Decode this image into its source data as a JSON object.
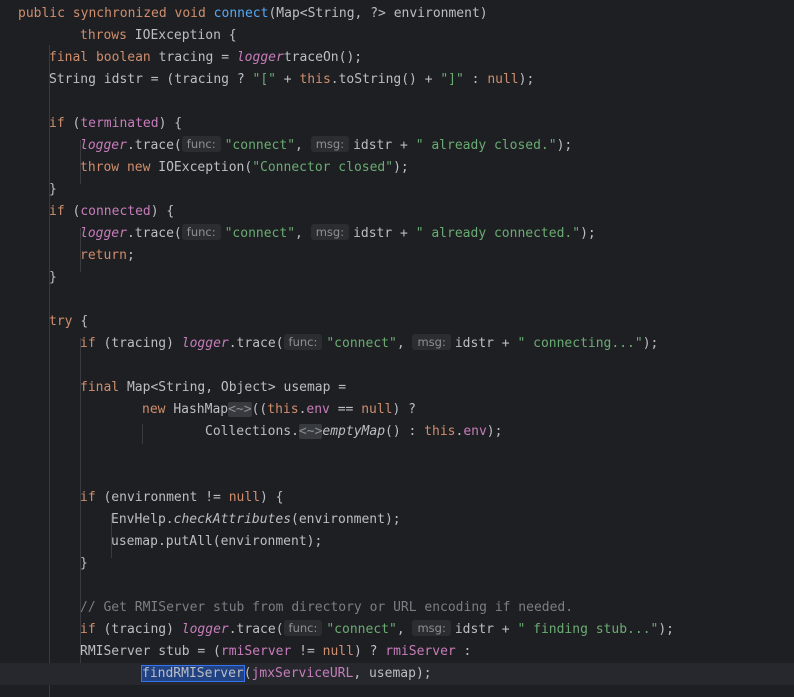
{
  "code": {
    "l1": {
      "t1": "public synchronized void ",
      "t2": "connect",
      "t3": "(Map<String, ?> environment)"
    },
    "l2": {
      "t1": "throws ",
      "t2": "IOException {"
    },
    "l3": {
      "t1": "final boolean ",
      "t2": "tracing = ",
      "t3": "logger",
      ".": ".",
      "t4": "traceOn();"
    },
    "l4": {
      "t1": "String idstr = (tracing ? ",
      "t2": "\"[\"",
      "t3": " + ",
      "t4": "this",
      "t5": ".toString() + ",
      "t6": "\"]\"",
      "t7": " : ",
      "t8": "null",
      "t9": ");"
    },
    "l5": {
      "t1": "if ",
      "t2": "(",
      "t3": "terminated",
      "t4": ") {"
    },
    "l6": {
      "t1": "logger",
      "t2": ".trace(",
      "h1": "func:",
      "t3": "\"connect\"",
      "t4": ", ",
      "h2": "msg:",
      "t5": "idstr + ",
      "t6": "\" already closed.\"",
      "t7": ");"
    },
    "l7": {
      "t1": "throw new ",
      "t2": "IOException(",
      "t3": "\"Connector closed\"",
      "t4": ");"
    },
    "l8": {
      "t1": "}"
    },
    "l9": {
      "t1": "if ",
      "t2": "(",
      "t3": "connected",
      "t4": ") {"
    },
    "l10": {
      "t1": "logger",
      "t2": ".trace(",
      "h1": "func:",
      "t3": "\"connect\"",
      "t4": ", ",
      "h2": "msg:",
      "t5": "idstr + ",
      "t6": "\" already connected.\"",
      "t7": ");"
    },
    "l11": {
      "t1": "return",
      ";": ";"
    },
    "l12": {
      "t1": "}"
    },
    "l13": {
      "t1": "try ",
      "t2": "{"
    },
    "l14": {
      "t1": "if ",
      "t2": "(tracing) ",
      "t3": "logger",
      "t4": ".trace(",
      "h1": "func:",
      "t5": "\"connect\"",
      "t6": ", ",
      "h2": "msg:",
      "t7": "idstr + ",
      "t8": "\" connecting...\"",
      "t9": ");"
    },
    "l15": {
      "t1": "final ",
      "t2": "Map<String, Object> usemap ="
    },
    "l16": {
      "t1": "new ",
      "t2": "HashMap",
      "t3": "<~>",
      "t4": "((",
      "t5": "this",
      "t6": ".",
      "t7": "env",
      "t8": " == ",
      "t9": "null",
      "t10": ") ?"
    },
    "l17": {
      "t1": "Collections.",
      "t2": "<~>",
      "t3": "emptyMap",
      "t4": "() : ",
      "t5": "this",
      "t6": ".",
      "t7": "env",
      "t8": ");"
    },
    "l18": {
      "t1": "if ",
      "t2": "(environment != ",
      "t3": "null",
      "t4": ") {"
    },
    "l19": {
      "t1": "EnvHelp.",
      "t2": "checkAttributes",
      "t3": "(environment);"
    },
    "l20": {
      "t1": "usemap.putAll(environment);"
    },
    "l21": {
      "t1": "}"
    },
    "l22": {
      "t1": "// Get RMIServer stub from directory or URL encoding if needed."
    },
    "l23": {
      "t1": "if ",
      "t2": "(tracing) ",
      "t3": "logger",
      "t4": ".trace(",
      "h1": "func:",
      "t5": "\"connect\"",
      "t6": ", ",
      "h2": "msg:",
      "t7": "idstr + ",
      "t8": "\" finding stub...\"",
      "t9": ");"
    },
    "l24": {
      "t1": "RMIServer stub = (",
      "t2": "rmiServer",
      "t3": " != ",
      "t4": "null",
      "t5": ") ? ",
      "t6": "rmiServer",
      "t7": " :"
    },
    "l25": {
      "t1": "findRMIServer",
      "t2": "(",
      "t3": "jmxServiceURL",
      "t4": ", usemap);"
    }
  }
}
